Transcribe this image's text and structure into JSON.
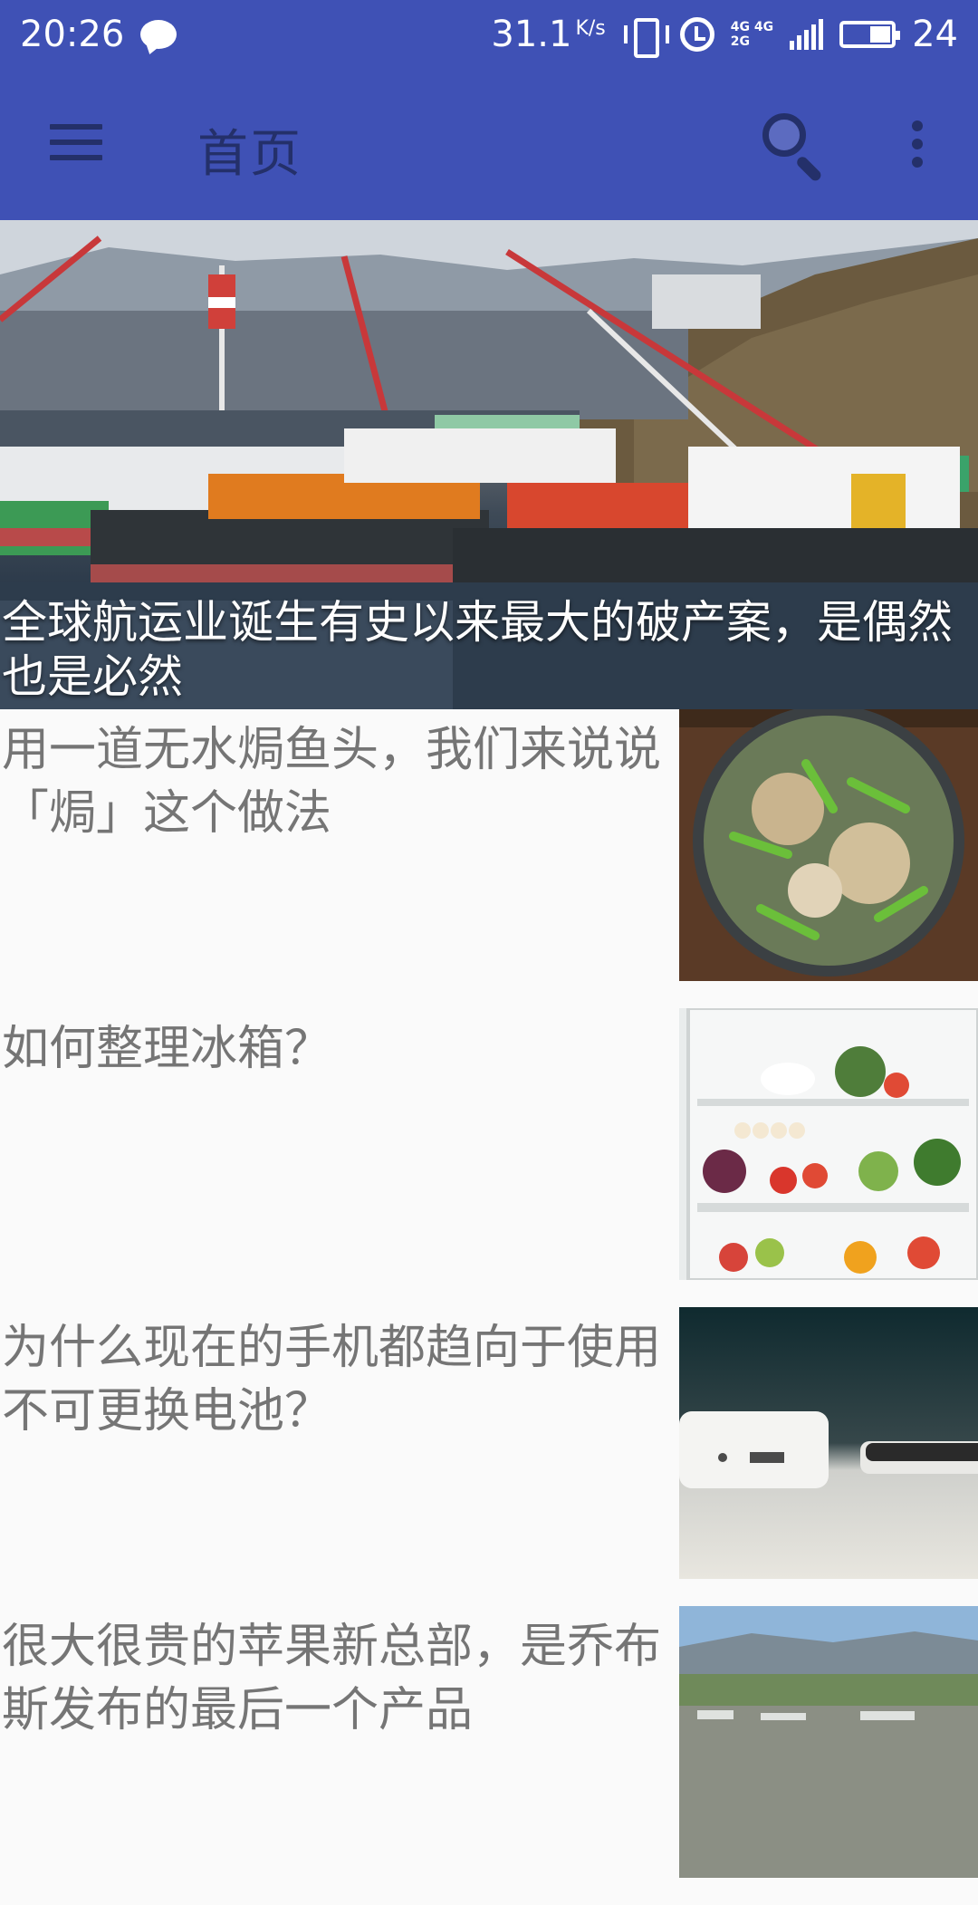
{
  "status_bar": {
    "time": "20:26",
    "speed": "31.1",
    "speed_unit": "K/s",
    "net_top": "4G 4G",
    "net_bottom": "2G",
    "battery_level": "24",
    "icons": [
      "chat-bubble-icon",
      "vibrate-icon",
      "alarm-icon",
      "signal-icon",
      "battery-icon"
    ]
  },
  "app_bar": {
    "title": "首页",
    "menu_icon": "hamburger-menu-icon",
    "search_icon": "search-icon",
    "more_icon": "more-vert-icon",
    "background": "#3f51b5",
    "icon_color": "#24306a"
  },
  "hero": {
    "title": "全球航运业诞生有史以来最大的破产案，是偶然也是必然",
    "image": "shipyard-harbor-photo"
  },
  "feed": [
    {
      "title": "用一道无水焗鱼头，我们来说说「焗」这个做法",
      "image": "fish-head-pot-photo"
    },
    {
      "title": "如何整理冰箱？",
      "image": "open-refrigerator-photo"
    },
    {
      "title": "为什么现在的手机都趋向于使用不可更换电池？",
      "image": "power-bank-phone-photo"
    },
    {
      "title": "很大很贵的苹果新总部，是乔布斯发布的最后一个产品",
      "image": "apple-campus-aerial-photo"
    }
  ]
}
